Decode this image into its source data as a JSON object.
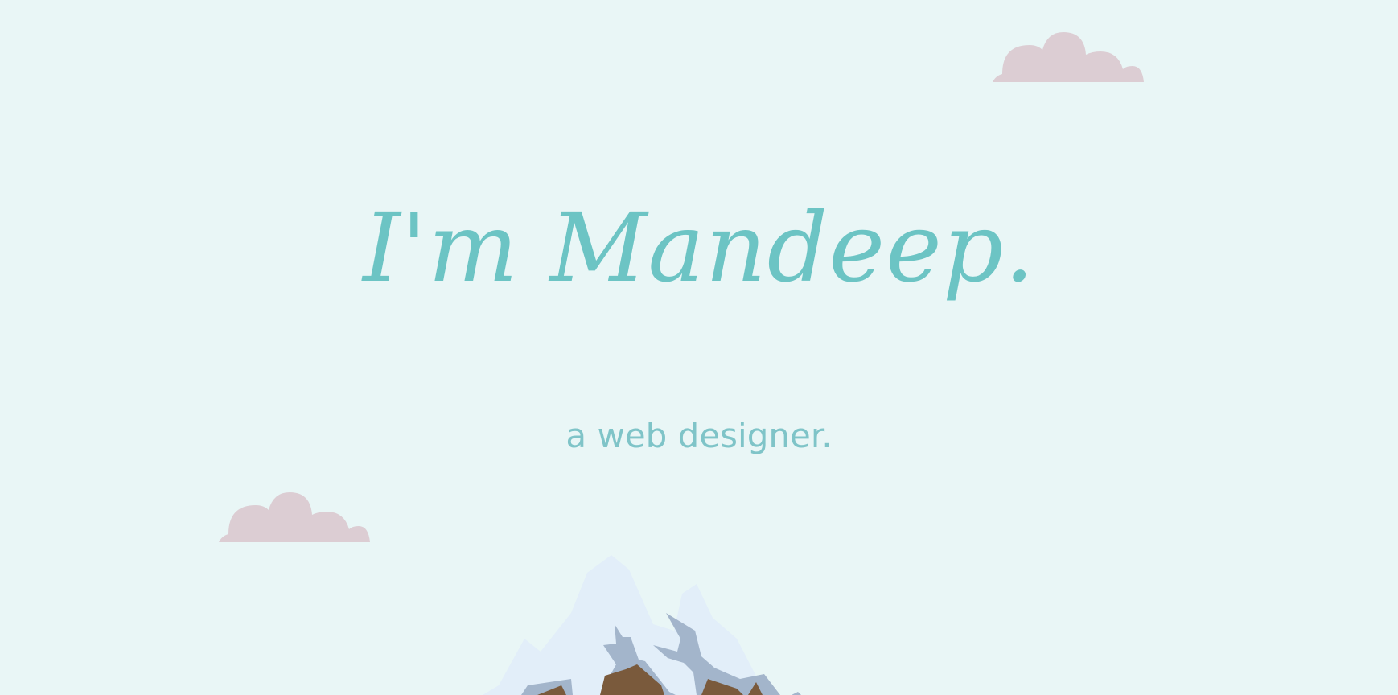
{
  "hero": {
    "title": "I'm Mandeep.",
    "subtitle": "a web designer."
  },
  "colors": {
    "background": "#e9f6f6",
    "accent": "#6cc4c4",
    "cloud": "#dccdd3",
    "snow": "#e2eef9",
    "rock": "#a3b5cb",
    "earth": "#7a5a3c"
  },
  "icons": {
    "cloud_top": "cloud-icon",
    "cloud_left": "cloud-icon",
    "mountain": "mountain-icon"
  }
}
